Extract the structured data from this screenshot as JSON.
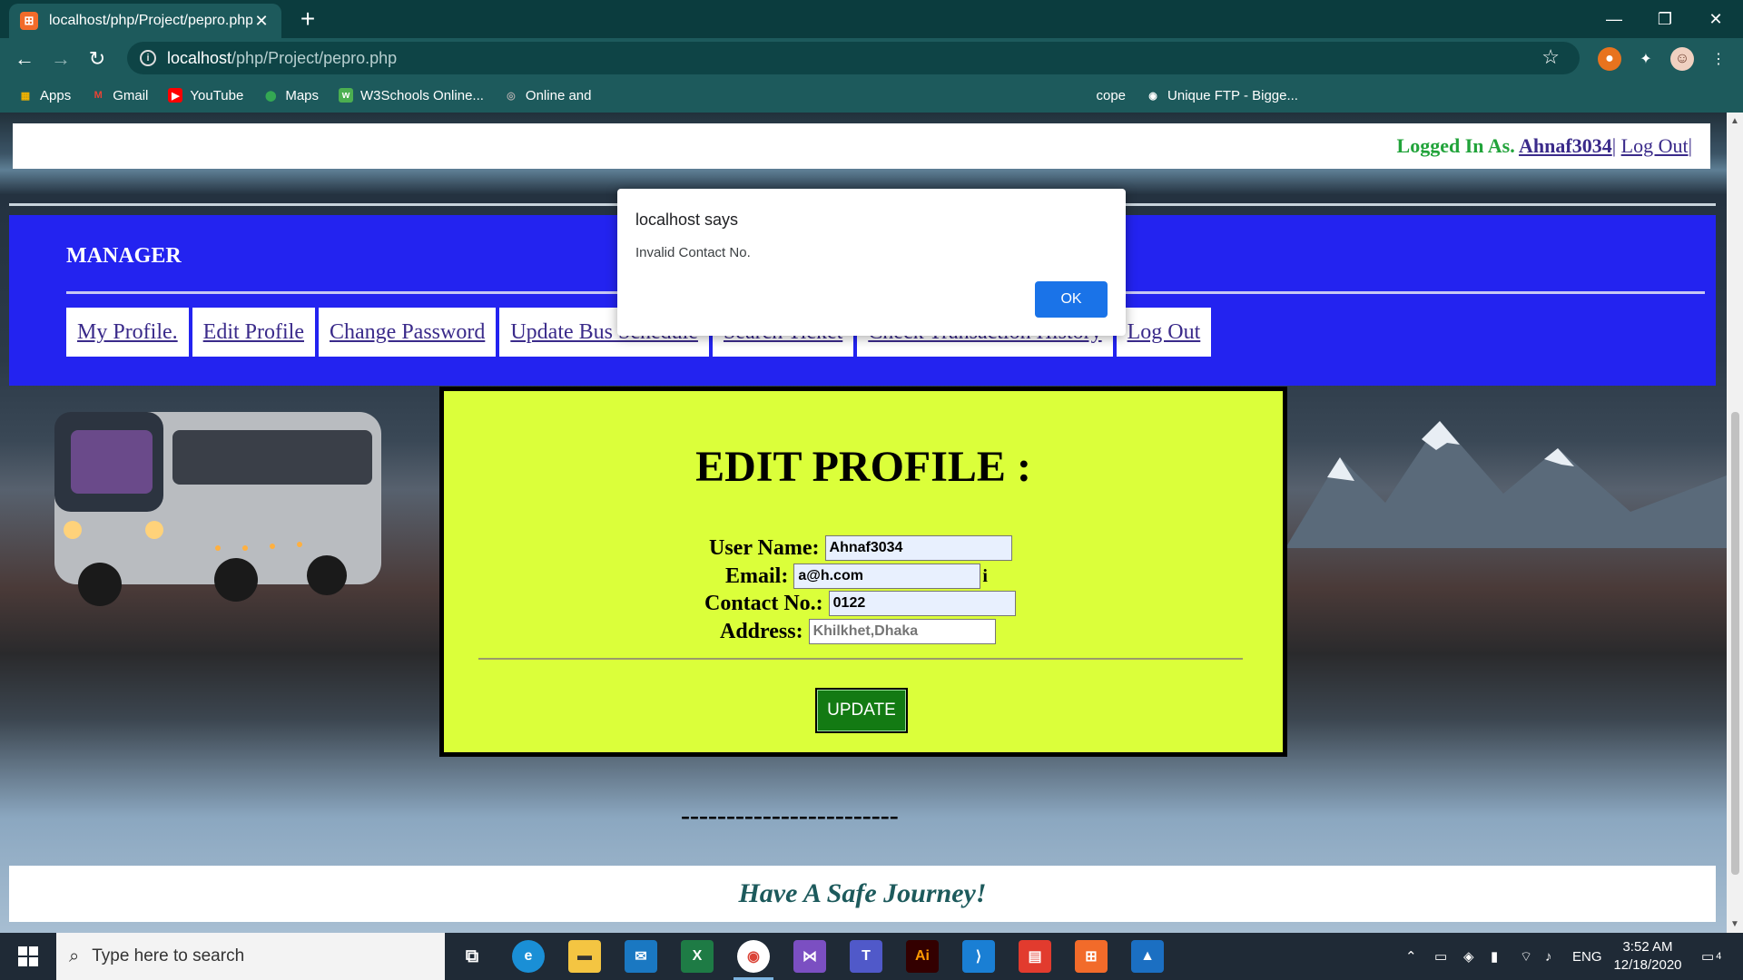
{
  "browser": {
    "tab_title": "localhost/php/Project/pepro.php",
    "favicon_text": "⊞",
    "url_host": "localhost",
    "url_path": "/php/Project/pepro.php",
    "bookmarks": [
      {
        "label": "Apps",
        "icon": "apps-grid-icon",
        "color": "#e8e8e8"
      },
      {
        "label": "Gmail",
        "icon": "gmail-icon",
        "color": "#ea4335"
      },
      {
        "label": "YouTube",
        "icon": "youtube-icon",
        "color": "#ff0000"
      },
      {
        "label": "Maps",
        "icon": "maps-pin-icon",
        "color": "#34a853"
      },
      {
        "label": "W3Schools Online...",
        "icon": "w3schools-icon",
        "color": "#4caf50"
      },
      {
        "label": "Online and",
        "icon": "globe-icon",
        "color": "#999999"
      },
      {
        "label": "cope",
        "icon": "",
        "color": ""
      },
      {
        "label": "Unique FTP - Bigge...",
        "icon": "globe-icon",
        "color": "#ffffff"
      }
    ]
  },
  "page": {
    "login_prefix": "Logged In As.",
    "username_link": "Ahnaf3034",
    "separator": "|",
    "logout_link": "Log Out",
    "logout_sep": "|",
    "manager_title": "MANAGER",
    "menu": [
      "My Profile.",
      "Edit Profile",
      "Change Password",
      "Update Bus Schedule",
      "Search Ticket",
      "Check Transaction History",
      "Log Out"
    ],
    "form": {
      "title": "EDIT PROFILE :",
      "username_label": "User Name:",
      "username_value": "Ahnaf3034",
      "email_label": "Email:",
      "email_value": "a@h.com",
      "email_suffix": "i",
      "contact_label": "Contact No.:",
      "contact_value": "0122",
      "address_label": "Address:",
      "address_placeholder": "Khilkhet,Dhaka",
      "update_label": "UPDATE"
    },
    "dashes": "------------------------",
    "footer_text": "Have A Safe Journey!"
  },
  "alert": {
    "title": "localhost says",
    "message": "Invalid Contact No.",
    "ok_label": "OK"
  },
  "taskbar": {
    "search_placeholder": "Type here to search",
    "language": "ENG",
    "time": "3:52 AM",
    "date": "12/18/2020",
    "notification_count": "4"
  },
  "colors": {
    "manager_band": "#2323f0",
    "form_panel": "#dbff3a",
    "login_green": "#21a33a",
    "update_button": "#137a13",
    "chrome_teal": "#1d5a5c"
  }
}
